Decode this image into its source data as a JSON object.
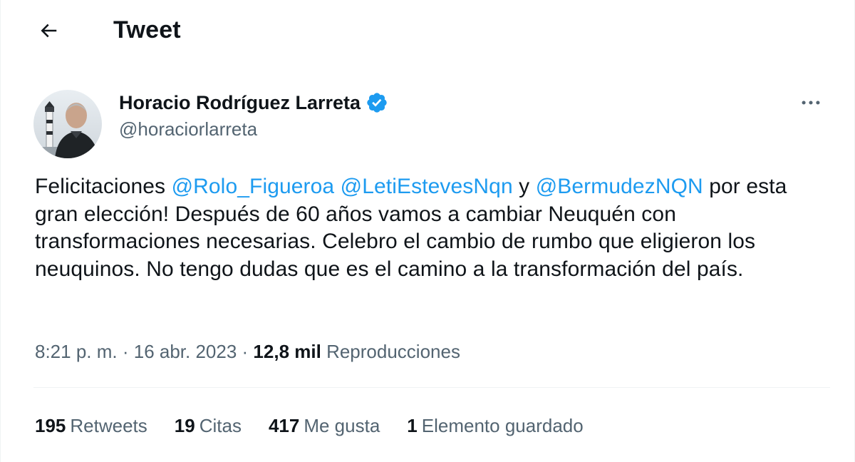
{
  "header": {
    "title": "Tweet",
    "back_icon": "arrow-left-icon"
  },
  "author": {
    "display_name": "Horacio Rodríguez Larreta",
    "handle": "@horaciorlarreta",
    "verified": true,
    "verified_color": "#1d9bf0"
  },
  "tweet": {
    "text_parts": {
      "p1": "Felicitaciones ",
      "m1": "@Rolo_Figueroa",
      "p2": " ",
      "m2": "@LetiEstevesNqn",
      "p3": " y ",
      "m3": "@BermudezNQN",
      "p4": " por esta gran elección! Después de 60 años vamos a cambiar Neuquén con transformaciones necesarias. Celebro el cambio de rumbo que eligieron los neuquinos. No tengo dudas que es el camino a la transformación del país."
    }
  },
  "meta": {
    "time": "8:21 p. m.",
    "date": "16 abr. 2023",
    "separator": " · ",
    "views_count": "12,8 mil",
    "views_label": "Reproducciones"
  },
  "stats": {
    "retweets_count": "195",
    "retweets_label": "Retweets",
    "quotes_count": "19",
    "quotes_label": "Citas",
    "likes_count": "417",
    "likes_label": "Me gusta",
    "bookmarks_count": "1",
    "bookmarks_label": "Elemento guardado"
  },
  "colors": {
    "text": "#0f1419",
    "secondary": "#536471",
    "link": "#1d9bf0",
    "divider": "#eff3f4"
  }
}
